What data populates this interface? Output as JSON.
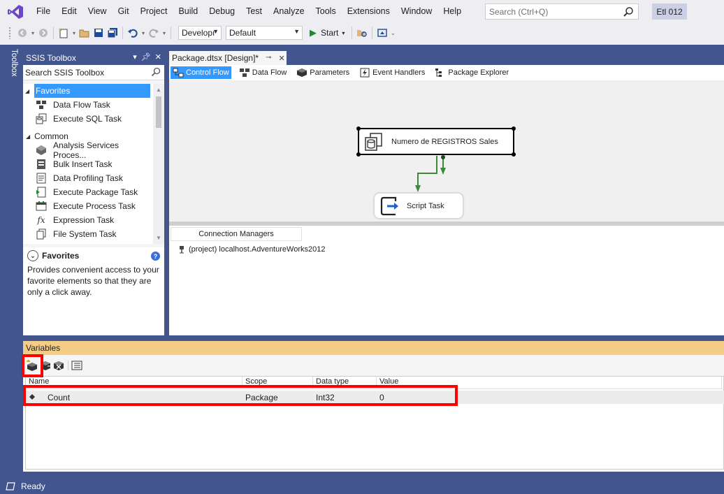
{
  "menu": {
    "items": [
      "File",
      "Edit",
      "View",
      "Git",
      "Project",
      "Build",
      "Debug",
      "Test",
      "Analyze",
      "Tools",
      "Extensions",
      "Window",
      "Help"
    ],
    "search_placeholder": "Search (Ctrl+Q)",
    "solution_name": "Etl 012"
  },
  "toolbar": {
    "config_combo": "Developı",
    "platform_combo": "Default",
    "start_label": "Start"
  },
  "toolbox_tab_label": "Toolbox",
  "toolbox": {
    "title": "SSIS Toolbox",
    "search_placeholder": "Search SSIS Toolbox",
    "groups": [
      {
        "label": "Favorites",
        "items": [
          "Data Flow Task",
          "Execute SQL Task"
        ]
      },
      {
        "label": "Common",
        "items": [
          "Analysis Services Proces...",
          "Bulk Insert Task",
          "Data Profiling Task",
          "Execute Package Task",
          "Execute Process Task",
          "Expression Task",
          "File System Task"
        ]
      }
    ],
    "desc_title": "Favorites",
    "desc_text": "Provides convenient access to your favorite elements so that they are only a click away."
  },
  "document": {
    "tab_label": "Package.dtsx [Design]*",
    "designer_tabs": [
      "Control Flow",
      "Data Flow",
      "Parameters",
      "Event Handlers",
      "Package Explorer"
    ],
    "tasks": [
      "Numero de REGISTROS Sales",
      "Script Task"
    ],
    "connection_managers_header": "Connection Managers",
    "connection_item": "(project) localhost.AdventureWorks2012"
  },
  "variables": {
    "title": "Variables",
    "columns": [
      "Name",
      "Scope",
      "Data type",
      "Value"
    ],
    "rows": [
      {
        "name": "Count",
        "scope": "Package",
        "type": "Int32",
        "value": "0"
      }
    ]
  },
  "status": {
    "text": "Ready"
  },
  "colors": {
    "frame": "#42558e",
    "selection": "#3399ff",
    "variables_header": "#f5cc84",
    "highlight": "#ff0000",
    "connector": "#3a8a3a"
  }
}
